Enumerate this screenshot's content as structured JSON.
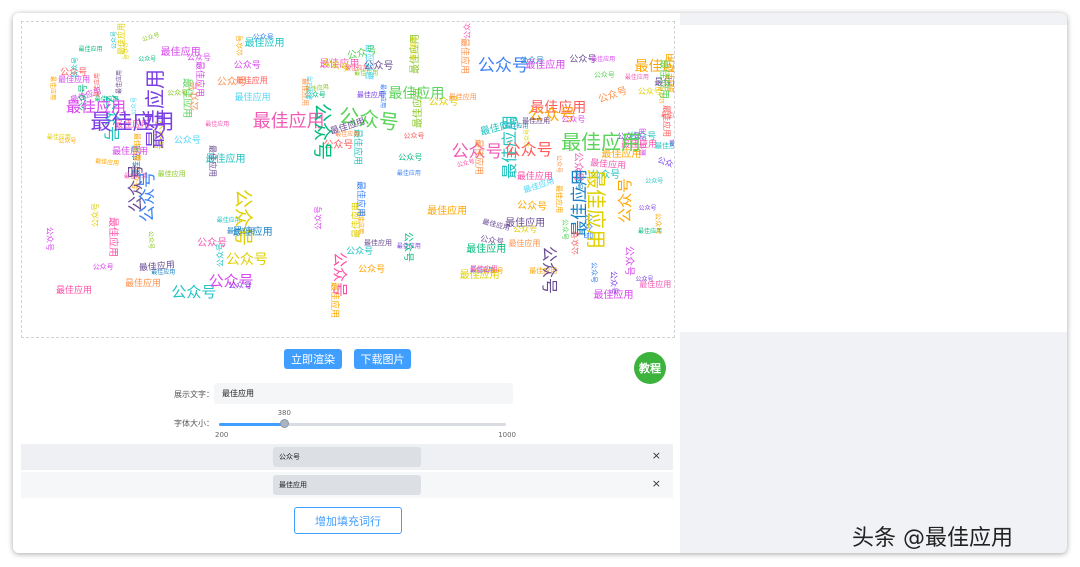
{
  "app": {
    "tutorial_label": "教程",
    "watermark": "头条 @最佳应用"
  },
  "toolbar": {
    "render_label": "立即渲染",
    "download_label": "下载图片"
  },
  "form": {
    "text_label": "展示文字：",
    "text_value": "最佳应用",
    "font_size_label": "字体大小：",
    "font_size_value": "380",
    "font_size_min": "200",
    "font_size_max": "1000"
  },
  "fill_words": [
    {
      "value": "公众号",
      "delete_icon": "×"
    },
    {
      "value": "最佳应用",
      "delete_icon": "×"
    }
  ],
  "add_row_label": "增加填充词行",
  "cloud": {
    "words": [
      "公众号",
      "最佳应用"
    ],
    "colors": [
      "#ff5a5a",
      "#ffa600",
      "#e0d000",
      "#5ad45a",
      "#22c3c3",
      "#3b82f6",
      "#7b3fe4",
      "#d946ef",
      "#ff4da6",
      "#8ac926",
      "#1982c4",
      "#6a4c93",
      "#ff924c",
      "#52d7f7",
      "#f15bb5",
      "#00bb7a"
    ]
  }
}
